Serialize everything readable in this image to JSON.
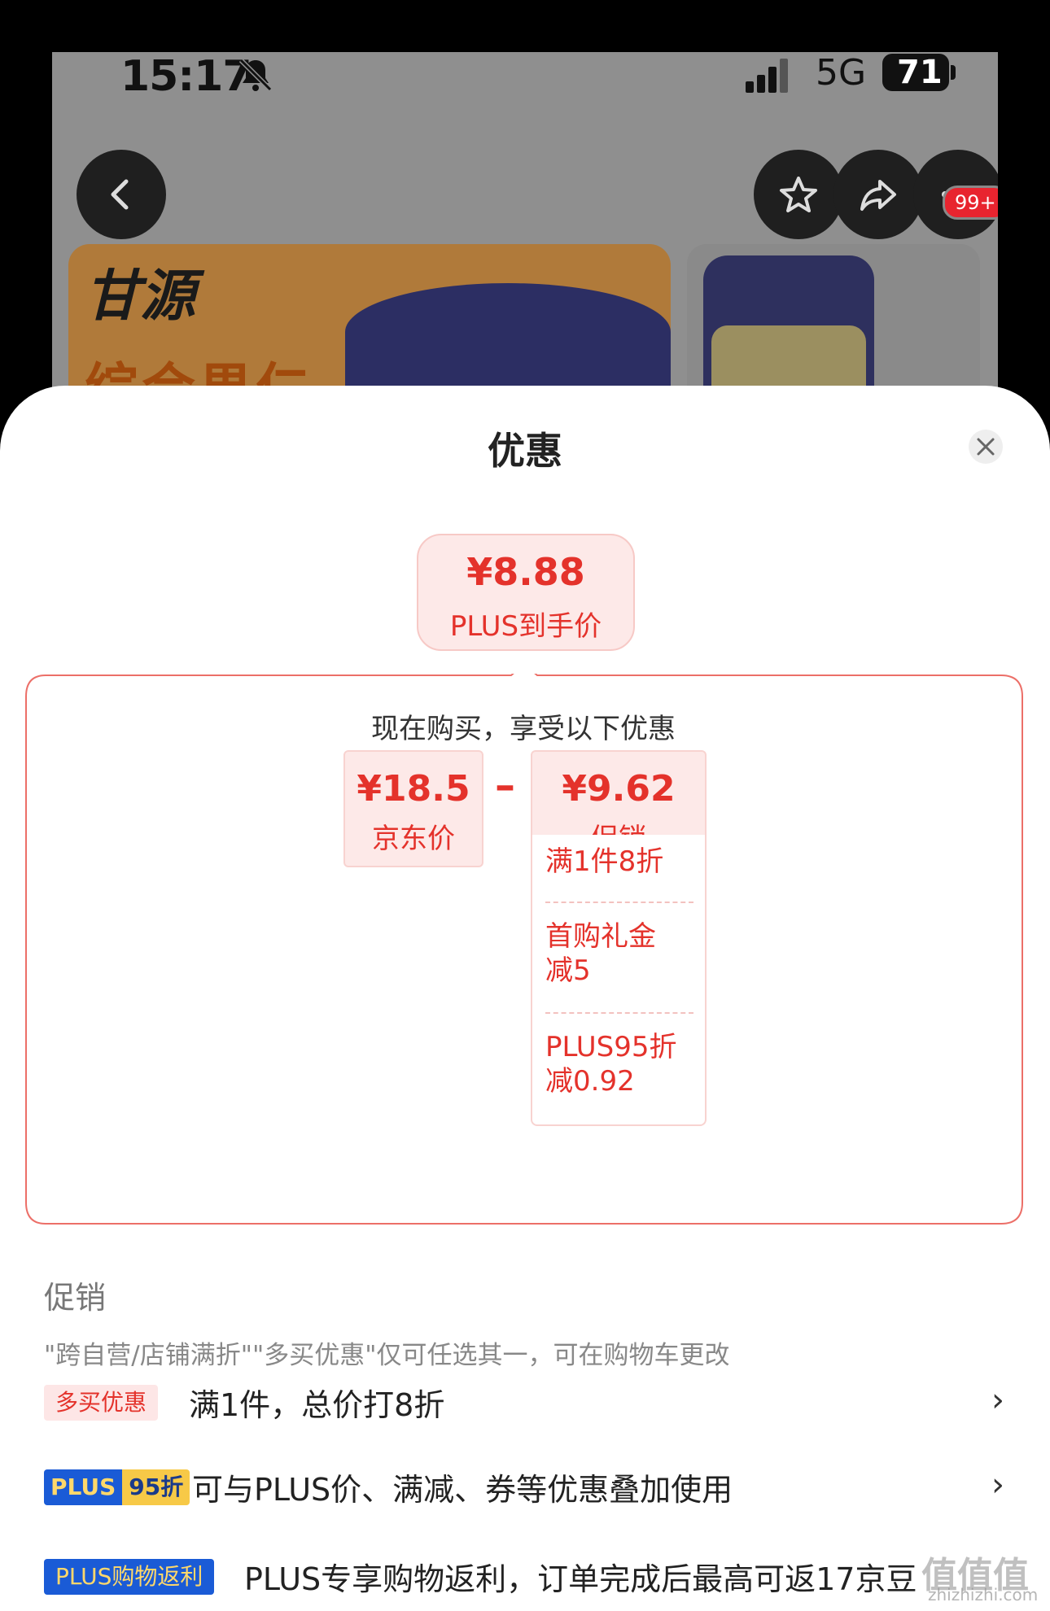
{
  "status_bar": {
    "time": "15:17",
    "network": "5G",
    "battery": "71"
  },
  "nav": {
    "badge": "99+"
  },
  "banner": {
    "brand": "甘源",
    "subtitle": "综合果仁"
  },
  "sheet": {
    "title": "优惠",
    "final_price": {
      "value": "¥8.88",
      "label": "PLUS到手价"
    },
    "calc": {
      "heading": "现在购买，享受以下优惠",
      "jd_price": {
        "value": "¥18.5",
        "label": "京东价"
      },
      "operator": "–",
      "promo_price": {
        "value": "¥9.62",
        "label": "促销"
      },
      "items": [
        {
          "line1": "满1件8折",
          "line2": ""
        },
        {
          "line1": "首购礼金",
          "line2": "减5"
        },
        {
          "line1": "PLUS95折",
          "line2": "减0.92"
        }
      ]
    },
    "promotions": {
      "title": "促销",
      "note": "\"跨自营/店铺满折\"\"多买优惠\"仅可任选其一，可在购物车更改",
      "rows": [
        {
          "tag": "多买优惠",
          "text": "满1件，总价打8折"
        },
        {
          "tag_a": "PLUS",
          "tag_b": "95折",
          "text": "可与PLUS价、满减、券等优惠叠加使用"
        },
        {
          "tag": "PLUS购物返利",
          "text": "PLUS专享购物返利，订单完成后最高可返17京豆"
        }
      ]
    }
  },
  "watermark": {
    "text": "值值值",
    "sub": "zhizhizhi.com"
  },
  "colors": {
    "accent": "#e4322b",
    "plus_blue": "#1a5bd6",
    "plus_gold": "#f7c947"
  }
}
